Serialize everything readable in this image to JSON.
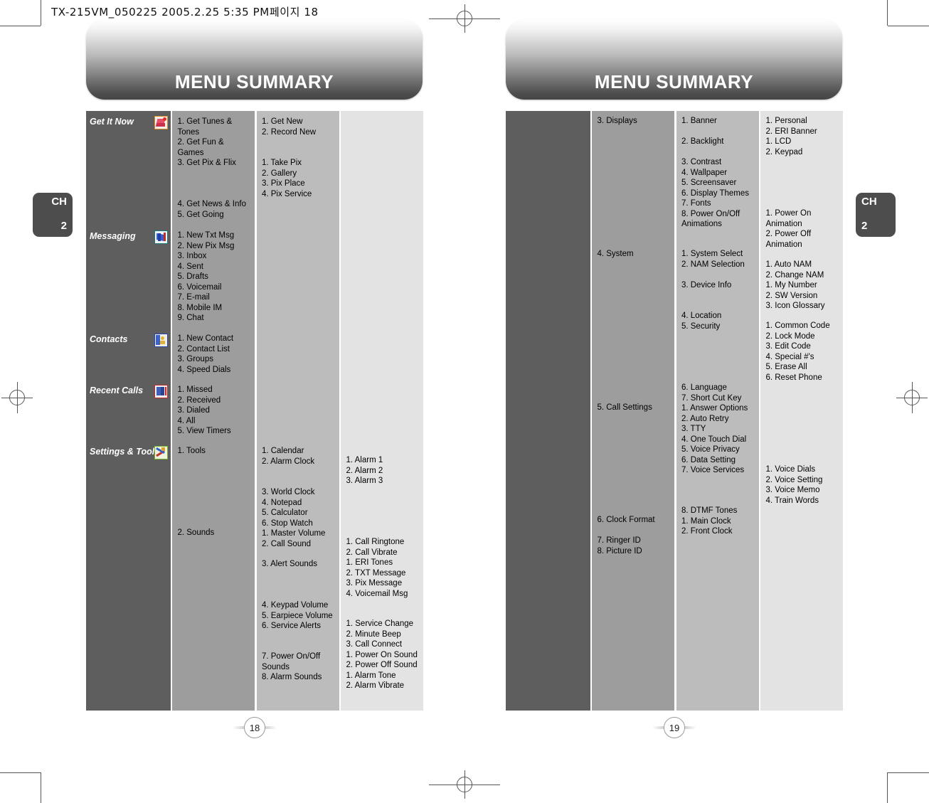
{
  "slug": "TX-215VM_050225  2005.2.25 5:35 PM페이지 18",
  "colors": {
    "col_dark": "#5e5e5e",
    "col_mid": "#9d9d9d",
    "col_light": "#bcbcbc",
    "col_lightest": "#e3e3e3",
    "banner_text": "#ffffff",
    "chapter_tab": "#4d4d4d"
  },
  "left_page": {
    "banner_title": "MENU SUMMARY",
    "chapter_label": "CH",
    "chapter_number": "2",
    "folio": "18",
    "categories": [
      {
        "label": "Get It Now",
        "icon": "get-it-now-icon"
      },
      {
        "label": "Messaging",
        "icon": "messaging-icon"
      },
      {
        "label": "Contacts",
        "icon": "contacts-icon"
      },
      {
        "label": "Recent Calls",
        "icon": "recent-calls-icon"
      },
      {
        "label": "Settings & Tools",
        "icon": "settings-tools-icon"
      }
    ],
    "level1": [
      "1. Get Tunes &\n    Tones\n2. Get Fun &\n    Games\n3. Get Pix & Flix",
      "4. Get News & Info\n5. Get Going",
      "1. New Txt Msg\n2. New Pix Msg\n3. Inbox\n4. Sent\n5. Drafts\n6. Voicemail\n7. E-mail\n8. Mobile IM\n9. Chat",
      "1. New Contact\n2. Contact List\n3. Groups\n4. Speed Dials",
      "1. Missed\n2. Received\n3. Dialed\n4. All\n5. View Timers",
      "1. Tools",
      "2. Sounds"
    ],
    "level2": [
      "1. Get New\n2. Record New",
      "1. Take Pix\n2. Gallery\n3. Pix Place\n4. Pix Service",
      "1. Calendar\n2. Alarm Clock",
      "3. World Clock\n4. Notepad\n5. Calculator\n6. Stop Watch\n1. Master Volume\n2. Call Sound",
      "3. Alert Sounds",
      "4. Keypad Volume\n5. Earpiece Volume\n6. Service Alerts",
      "7. Power On/Off\n    Sounds\n8. Alarm Sounds"
    ],
    "level3": [
      "1. Alarm 1\n2. Alarm 2\n3. Alarm 3",
      "1. Call Ringtone\n2. Call Vibrate\n1. ERI Tones\n2. TXT Message\n3. Pix Message\n4. Voicemail Msg",
      "1. Service Change\n2. Minute Beep\n3. Call Connect\n1. Power On Sound\n2. Power Off Sound\n1. Alarm Tone\n2. Alarm Vibrate"
    ]
  },
  "right_page": {
    "banner_title": "MENU SUMMARY",
    "chapter_label": "CH",
    "chapter_number": "2",
    "folio": "19",
    "level1": [
      "3. Displays",
      "4. System",
      "5. Call Settings",
      "6. Clock Format",
      "7. Ringer ID\n8. Picture ID"
    ],
    "level2": [
      "1. Banner",
      "2. Backlight",
      "3. Contrast\n4. Wallpaper\n5. Screensaver\n6. Display Themes\n7. Fonts\n8. Power On/Off\n    Animations",
      "1. System Select\n2. NAM Selection",
      "3. Device Info",
      "4. Location\n5. Security",
      "6. Language\n7. Short Cut Key\n1. Answer Options\n2. Auto Retry\n3. TTY\n4. One Touch Dial\n5. Voice Privacy\n6. Data Setting\n7. Voice Services",
      "8. DTMF Tones\n1. Main Clock\n2. Front Clock"
    ],
    "level3": [
      "1. Personal\n2. ERI Banner\n1. LCD\n2. Keypad",
      "1. Power On\n    Animation\n2. Power Off\n    Animation",
      "1. Auto NAM\n2. Change NAM\n1. My Number\n2. SW Version\n3. Icon Glossary",
      "1. Common Code\n2. Lock Mode\n3. Edit Code\n4. Special #'s\n5. Erase All\n6. Reset Phone",
      "1. Voice Dials\n2. Voice Setting\n3. Voice Memo\n4. Train Words"
    ]
  }
}
